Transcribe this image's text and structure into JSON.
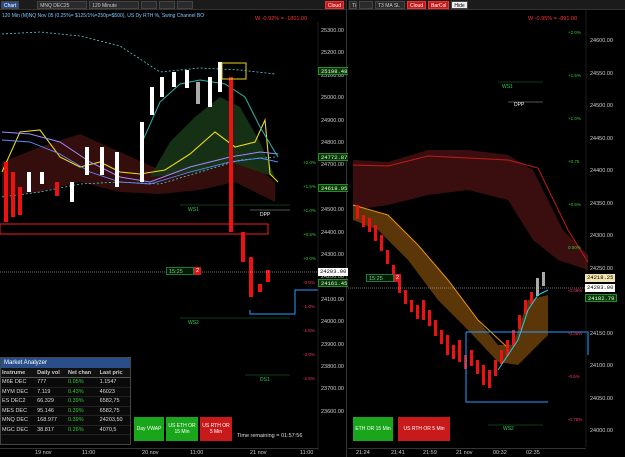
{
  "left": {
    "toolbar": {
      "chart_tab": "Chart",
      "instrument": "MNQ DEC25",
      "timeframe": "120 Minute",
      "cloud": "Cloud"
    },
    "status_line": "120 Min (M)NQ Nov 05 (0.25%= $125/1%=250p=$500), US Dy RTH %, Swing Channel BO",
    "pnl": "W -0.92% = -1801.00",
    "y_labels": [
      "25300.00",
      "25200.00",
      "25100.00",
      "25000.00",
      "24900.00",
      "24800.00",
      "24700.00",
      "24600.00",
      "24500.00",
      "24400.00",
      "24300.00",
      "24200.00",
      "24100.00",
      "24000.00",
      "23900.00",
      "23800.00",
      "23700.00",
      "23600.00"
    ],
    "price_tags": {
      "high": "25198.48",
      "upper": "24772.87",
      "mid": "24618.95",
      "last": "24203.00",
      "low": "24161.45"
    },
    "time_box": "15:25",
    "time_box_num": "2",
    "pct_labels": [
      "+2.0%",
      "+1.5%",
      "+1.0%",
      "+0.5%",
      "+0.0%",
      "-0.5%",
      "-1.0%",
      "-1.5%",
      "-2.0%",
      "-2.5%"
    ],
    "levels": {
      "ws1": "WS1",
      "dpp": "DPP",
      "ws2": "WS2",
      "ds1": "DS1"
    },
    "x_labels": [
      "19 nov",
      "11:00",
      "20 nov",
      "11:00",
      "21 nov",
      "11:00"
    ],
    "buttons": {
      "day_vwap": "Day VWAP",
      "us_eth": "US ETH OR\n15 Min",
      "us_rth": "US RTH OR\n5 Min"
    },
    "time_remaining": "Time remaining = 01:57:56"
  },
  "right": {
    "toolbar": {
      "tab": "Ti",
      "series": "T3 MA SL",
      "cloud": "Cloud",
      "barcol": "BarCol",
      "hide": "Hide"
    },
    "pnl": "W -0.95% = -891.00",
    "y_labels": [
      "24600.00",
      "24550.00",
      "24500.00",
      "24450.00",
      "24400.00",
      "24350.00",
      "24300.00",
      "24250.00",
      "24200.00",
      "24150.00",
      "24100.00",
      "24050.00",
      "24000.00"
    ],
    "price_tags": {
      "upper": "24218.25",
      "last": "24203.00",
      "low": "24182.79"
    },
    "time_box": "15:25",
    "time_box_num": "2",
    "pct_labels": [
      "+2.0%",
      "+1.5%",
      "+1.0%",
      "+0.75",
      "+0.5%",
      "0.00%",
      "-0.06%",
      "-0.25%",
      "-0.5%",
      "-0.75%"
    ],
    "levels": {
      "ws1": "WS1",
      "dpp": "DPP",
      "ws2": "WS2"
    },
    "x_labels": [
      "21:24",
      "21:41",
      "21:59",
      "21 nov",
      "00:32",
      "02:35"
    ],
    "buttons": {
      "us_eth": "ETH OR 15 Min",
      "us_rth": "US RTH OR 5 Min"
    }
  },
  "market_analyzer": {
    "title": "Market Analyzer",
    "columns": [
      "Instrume",
      "Daily vol",
      "Net chan",
      "Last pric"
    ],
    "rows": [
      [
        "M6E DEC",
        "777",
        "0.05%",
        "1.1547"
      ],
      [
        "MYM DEC",
        "7.119",
        "0.43%",
        "46023"
      ],
      [
        "ES DEC2",
        "66.329",
        "0.39%",
        "6582,75"
      ],
      [
        "MES DEC",
        "95.146",
        "0.39%",
        "6582,75"
      ],
      [
        "MNQ DEC",
        "168.977",
        "0.39%",
        "24203,50"
      ],
      [
        "MGC DEC",
        "38.817",
        "0.26%",
        "4070,5"
      ]
    ]
  },
  "colors": {
    "accent_red": "#d91a1a",
    "accent_green": "#1aa61a",
    "positive": "#33cc33",
    "negative": "#ff3333",
    "panel_bg": "#000000"
  }
}
